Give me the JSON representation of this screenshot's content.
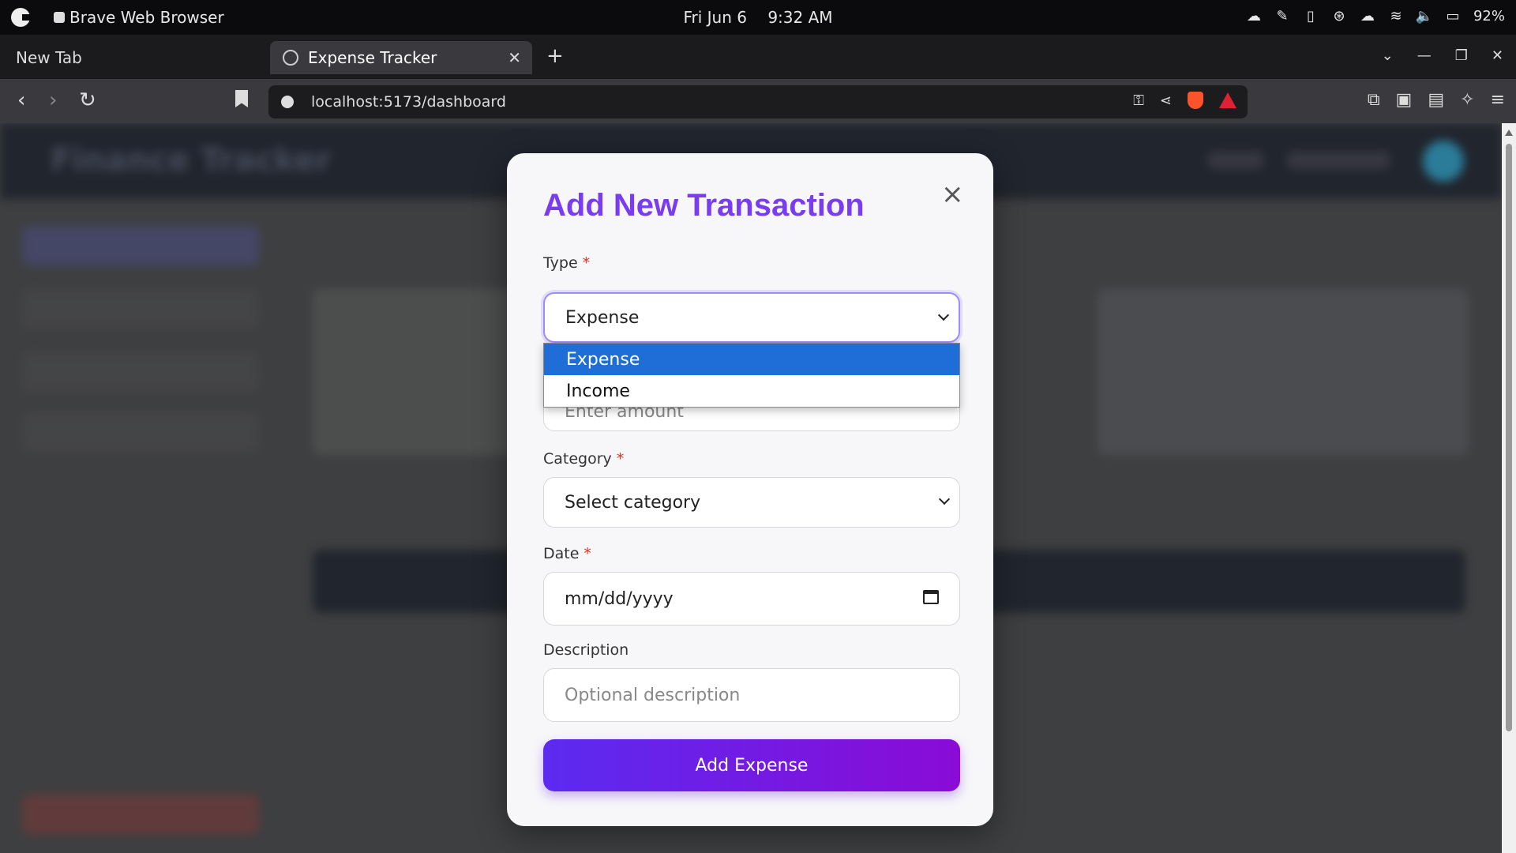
{
  "system_bar": {
    "app_name": "Brave Web Browser",
    "date": "Fri Jun 6",
    "time": "9:32 AM",
    "battery": "92%"
  },
  "tabs": [
    {
      "label": "New Tab",
      "active": false
    },
    {
      "label": "Expense Tracker",
      "active": true
    }
  ],
  "address_bar": {
    "url": "localhost:5173/dashboard"
  },
  "background_app": {
    "brand": "Finance Tracker"
  },
  "modal": {
    "title": "Add New Transaction",
    "type_label": "Type",
    "type_value": "Expense",
    "type_options": [
      "Expense",
      "Income"
    ],
    "amount_placeholder": "Enter amount",
    "category_label": "Category",
    "category_value": "Select category",
    "date_label": "Date",
    "date_placeholder": "mm/dd/yyyy",
    "description_label": "Description",
    "description_placeholder": "Optional description",
    "submit_label": "Add Expense",
    "required_marker": "*"
  },
  "colors": {
    "title_purple": "#7a3cf0",
    "button_gradient_start": "#5b2bf0",
    "button_gradient_end": "#8a0bd6",
    "option_highlight": "#1f6ed8",
    "required_red": "#d32f2f"
  }
}
